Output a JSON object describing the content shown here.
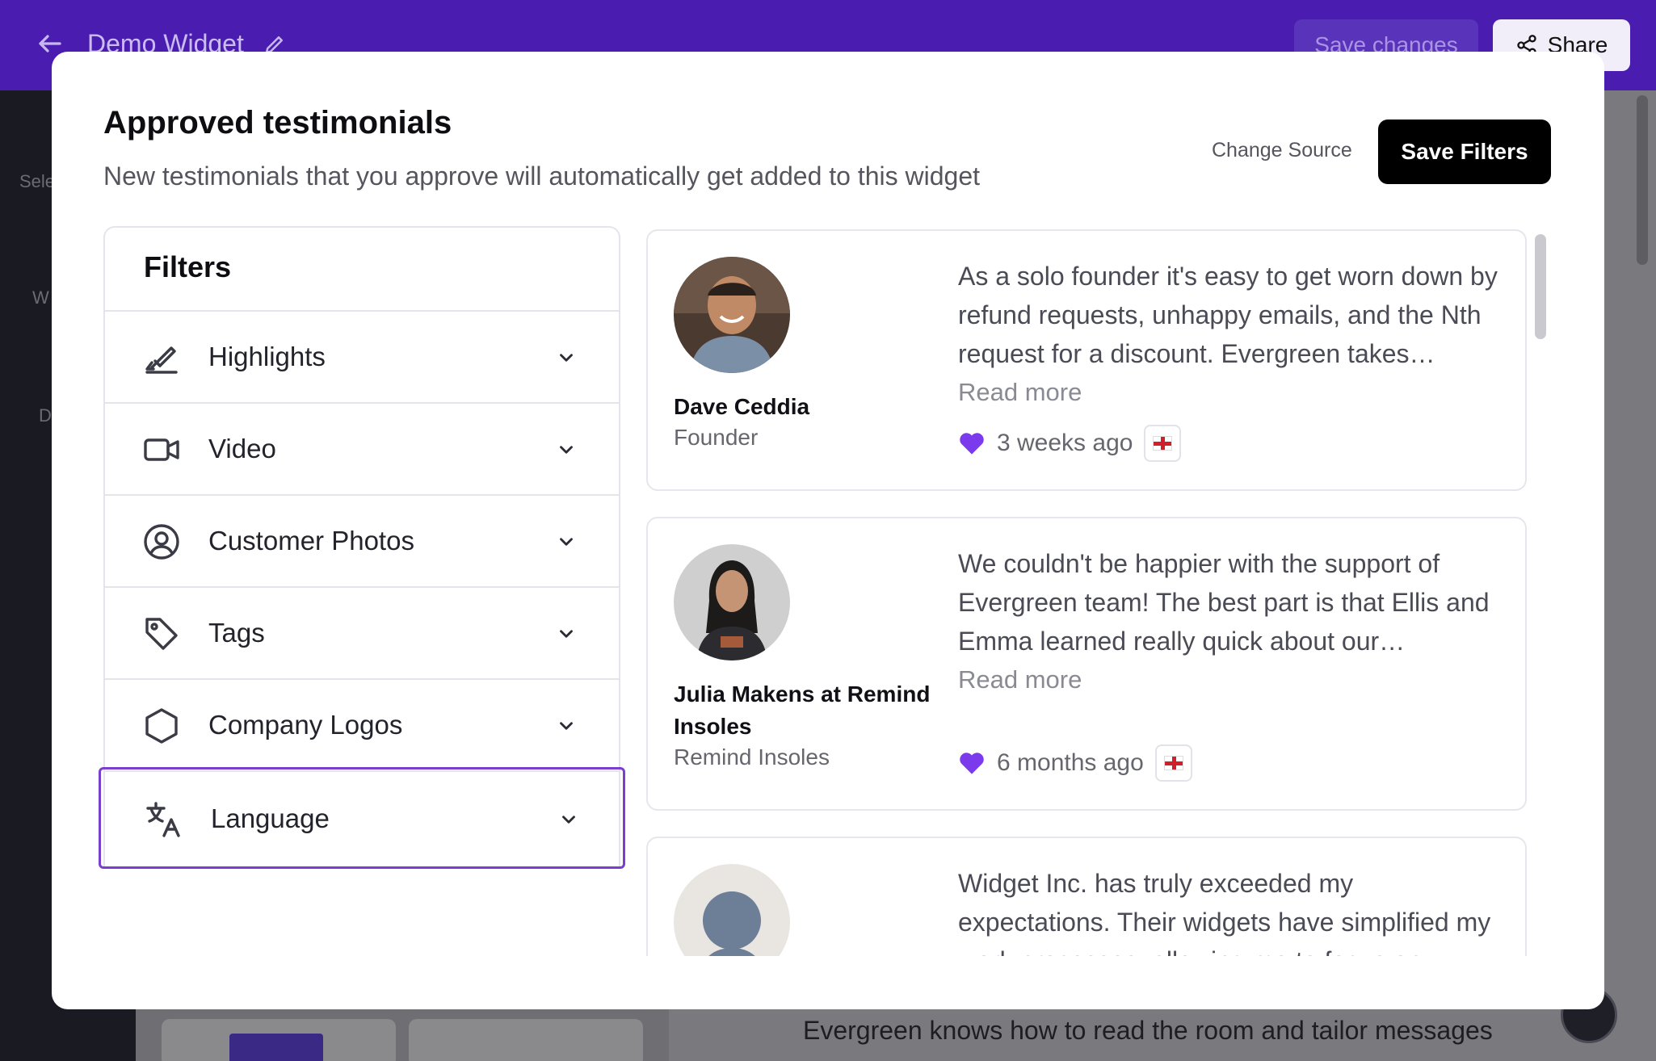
{
  "app": {
    "widget_title": "Demo Widget",
    "save_changes_label": "Save changes",
    "share_label": "Share",
    "rail_text_1": "Sele",
    "rail_text_2": "W",
    "rail_text_3": "D",
    "background_text": "Evergreen knows how to read the room and tailor messages"
  },
  "modal": {
    "title": "Approved testimonials",
    "subtitle": "New testimonials that you approve will automatically get added to this widget",
    "change_source_label": "Change Source",
    "save_filters_label": "Save Filters"
  },
  "filters": {
    "heading": "Filters",
    "items": [
      {
        "label": "Highlights",
        "icon": "highlighter-icon"
      },
      {
        "label": "Video",
        "icon": "video-camera-icon"
      },
      {
        "label": "Customer Photos",
        "icon": "user-circle-icon"
      },
      {
        "label": "Tags",
        "icon": "tag-icon"
      },
      {
        "label": "Company Logos",
        "icon": "hexagon-icon"
      },
      {
        "label": "Language",
        "icon": "translate-icon",
        "active": true
      }
    ]
  },
  "testimonials": [
    {
      "name": "Dave Ceddia",
      "role": "Founder",
      "quote": "As a solo founder it's easy to get worn down by refund requests, unhappy emails, and the Nth request for a discount. Evergreen takes…",
      "read_more": "Read more",
      "time": "3 weeks ago"
    },
    {
      "name": "Julia Makens at Remind Insoles",
      "role": "Remind Insoles",
      "quote": "We couldn't be happier with the support of Evergreen team! The best part is that Ellis and Emma learned really quick about our…",
      "read_more": "Read more",
      "time": "6 months ago"
    },
    {
      "quote": "Widget Inc. has truly exceeded my expectations. Their widgets have simplified my work processes, allowing me to focus on"
    }
  ],
  "colors": {
    "brand_purple": "#4a1db0",
    "active_border": "#7b3fd0",
    "heart": "#7c3aed"
  }
}
